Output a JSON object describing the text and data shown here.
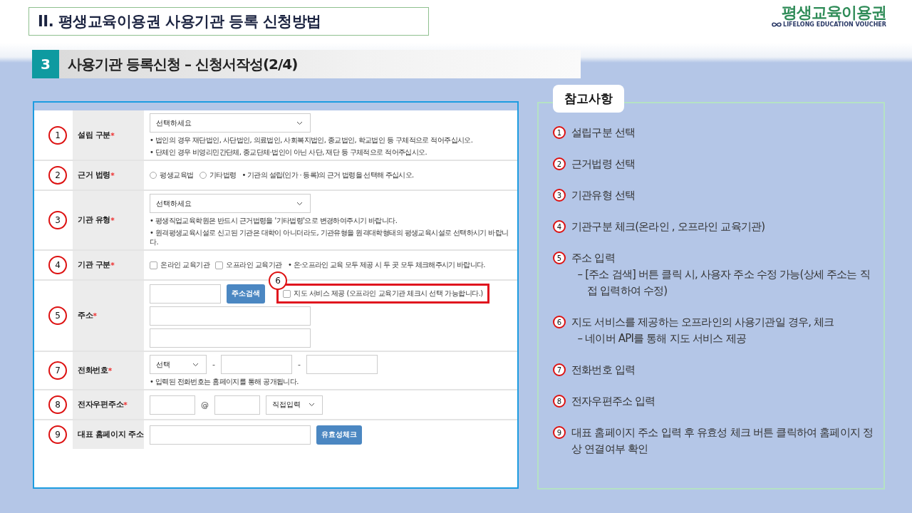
{
  "title": "II. 평생교육이용권 사용기관 등록 신청방법",
  "logo": {
    "name": "평생교육이용권",
    "tagline": "LIFELONG EDUCATION VOUCHER"
  },
  "section": {
    "number": "3",
    "title": "사용기관 등록신청 – 신청서작성(2/4)"
  },
  "form": {
    "rows": [
      {
        "marker": "1",
        "label": "설립 구분",
        "mark": "*",
        "lines": [
          {
            "controls": [
              {
                "kind": "select",
                "value": "선택하세요"
              }
            ]
          }
        ],
        "hints": [
          "• 법인의 경우 재단법인, 사단법인, 의료법인, 사회복지법인, 종교법인, 학교법인 등 구체적으로 적어주십시오.",
          "• 단체인 경우 비영리민간단체, 종교단체·법인이 아닌 사단, 재단 등 구체적으로 적어주십시오."
        ]
      },
      {
        "marker": "2",
        "label": "근거 법령",
        "mark": "*",
        "lines": [
          {
            "controls": [
              {
                "kind": "radio",
                "label": "평생교육법",
                "selected": false
              },
              {
                "kind": "radio",
                "label": "기타법령",
                "selected": false
              },
              {
                "kind": "note",
                "text": "• 기관의 설립(인가 · 등록)의 근거 법령을 선택해 주십시오."
              }
            ]
          }
        ]
      },
      {
        "marker": "3",
        "label": "기관 유형",
        "mark": "*",
        "lines": [
          {
            "controls": [
              {
                "kind": "select",
                "value": "선택하세요"
              }
            ]
          }
        ],
        "hints": [
          "• 평생직업교육학원은 반드시 근거법령을 '기타법령'으로 변경하여주시기 바랍니다.",
          "• 원격평생교육시설로 신고된 기관은 대학이 아니더라도, 기관유형을 원격대학형태의 평생교육시설로 선택하시기 바랍니다."
        ]
      },
      {
        "marker": "4",
        "label": "기관 구분",
        "mark": "*",
        "lines": [
          {
            "controls": [
              {
                "kind": "checkbox",
                "label": "온라인 교육기관",
                "checked": false
              },
              {
                "kind": "checkbox",
                "label": "오프라인 교육기관",
                "checked": false
              },
              {
                "kind": "note",
                "text": "• 온·오프라인 교육 모두 제공 시 두 곳 모두 체크해주시기 바랍니다."
              }
            ]
          }
        ]
      },
      {
        "marker": "5",
        "label": "주소",
        "mark": "*",
        "lines": [
          {
            "controls": [
              {
                "kind": "input"
              },
              {
                "kind": "button",
                "label": "주소검색"
              },
              {
                "kind": "highlight",
                "marker": "6",
                "control": {
                  "kind": "checkbox",
                  "label": "지도 서비스 제공 (오프라인 교육기관 체크시 선택 가능합니다.)",
                  "checked": false
                }
              }
            ]
          },
          {
            "controls": [
              {
                "kind": "long-input"
              }
            ]
          },
          {
            "controls": [
              {
                "kind": "long-input"
              }
            ]
          }
        ]
      },
      {
        "marker": "7",
        "label": "전화번호",
        "mark": "*",
        "lines": [
          {
            "controls": [
              {
                "kind": "short-select",
                "value": "선택"
              },
              {
                "kind": "separator",
                "text": "-"
              },
              {
                "kind": "input"
              },
              {
                "kind": "separator",
                "text": "-"
              },
              {
                "kind": "input"
              }
            ]
          }
        ],
        "hints": [
          "• 입력된 전화번호는 홈페이지를 통해 공개됩니다."
        ]
      },
      {
        "marker": "8",
        "label": "전자우편주소",
        "mark": "*",
        "lines": [
          {
            "controls": [
              {
                "kind": "short-input"
              },
              {
                "kind": "separator",
                "text": "@"
              },
              {
                "kind": "short-input"
              },
              {
                "kind": "short-select",
                "value": "직접입력"
              }
            ]
          }
        ]
      },
      {
        "marker": "9",
        "label": "대표 홈페이지 주소",
        "lines": [
          {
            "controls": [
              {
                "kind": "long-input"
              },
              {
                "kind": "button",
                "label": "유효성체크"
              }
            ]
          }
        ]
      }
    ]
  },
  "notes": {
    "title": "참고사항",
    "items": [
      {
        "number": "1",
        "text": "설립구분 선택"
      },
      {
        "number": "2",
        "text": "근거법령 선택"
      },
      {
        "number": "3",
        "text": "기관유형 선택"
      },
      {
        "number": "4",
        "text": "기관구분 체크(온라인 , 오프라인 교육기관)"
      },
      {
        "number": "5",
        "text": "주소 입력",
        "details": [
          "– [주소 검색] 버튼 클릭 시, 사용자 주소 수정 가능(상세 주소는 직접 입력하여 수정)"
        ]
      },
      {
        "number": "6",
        "text": "지도 서비스를 제공하는 오프라인의 사용기관일 경우, 체크",
        "details": [
          "– 네이버 API를 통해 지도 서비스 제공"
        ]
      },
      {
        "number": "7",
        "text": "전화번호 입력"
      },
      {
        "number": "8",
        "text": "전자우편주소 입력"
      },
      {
        "number": "9",
        "text": "대표 홈페이지 주소 입력 후 유효성 체크 버튼 클릭하여 홈페이지 정상 연결여부 확인"
      }
    ]
  }
}
